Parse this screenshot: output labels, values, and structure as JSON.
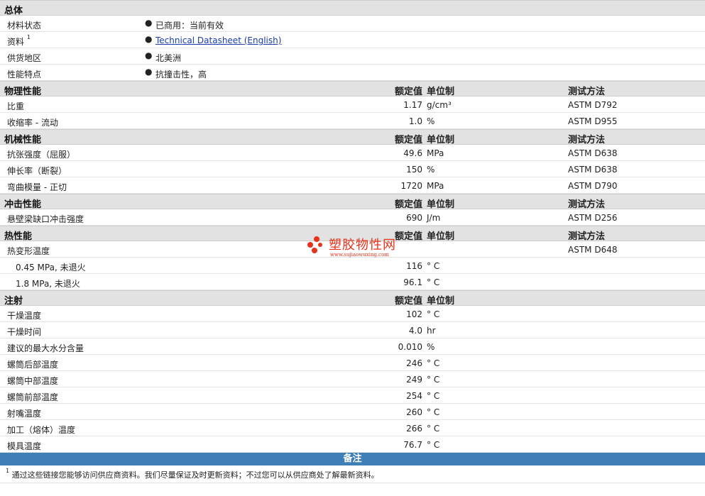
{
  "general": {
    "title": "总体",
    "rows": [
      {
        "label": "材料状态",
        "value": "已商用：当前有效"
      },
      {
        "label": "资料",
        "sup": "1",
        "value": "Technical Datasheet (English)",
        "link": true
      },
      {
        "label": "供货地区",
        "value": "北美洲"
      },
      {
        "label": "性能特点",
        "value": "抗撞击性，高"
      }
    ]
  },
  "cols": {
    "nominal": "额定值",
    "unit": "单位制",
    "method": "测试方法"
  },
  "sections": [
    {
      "title": "物理性能",
      "show_method": true,
      "rows": [
        {
          "label": "比重",
          "value": "1.17",
          "unit": "g/cm³",
          "method": "ASTM D792"
        },
        {
          "label": "收缩率 - 流动",
          "value": "1.0",
          "unit": "%",
          "method": "ASTM D955"
        }
      ]
    },
    {
      "title": "机械性能",
      "show_method": true,
      "rows": [
        {
          "label": "抗张强度（屈服）",
          "value": "49.6",
          "unit": "MPa",
          "method": "ASTM D638"
        },
        {
          "label": "伸长率（断裂）",
          "value": "150",
          "unit": "%",
          "method": "ASTM D638"
        },
        {
          "label": "弯曲模量 - 正切",
          "value": "1720",
          "unit": "MPa",
          "method": "ASTM D790"
        }
      ]
    },
    {
      "title": "冲击性能",
      "show_method": true,
      "rows": [
        {
          "label": "悬壁梁缺口冲击强度",
          "value": "690",
          "unit": "J/m",
          "method": "ASTM D256"
        }
      ]
    },
    {
      "title": "热性能",
      "show_method": true,
      "rows": [
        {
          "label": "热变形温度",
          "value": "",
          "unit": "",
          "method": "ASTM D648"
        },
        {
          "label": "0.45 MPa, 未退火",
          "value": "116",
          "unit": "° C",
          "method": "",
          "sub": true
        },
        {
          "label": "1.8 MPa, 未退火",
          "value": "96.1",
          "unit": "° C",
          "method": "",
          "sub": true
        }
      ]
    },
    {
      "title": "注射",
      "show_method": false,
      "rows": [
        {
          "label": "干燥温度",
          "value": "102",
          "unit": "° C",
          "method": ""
        },
        {
          "label": "干燥时间",
          "value": "4.0",
          "unit": "hr",
          "method": ""
        },
        {
          "label": "建议的最大水分含量",
          "value": "0.010",
          "unit": "%",
          "method": ""
        },
        {
          "label": "螺筒后部温度",
          "value": "246",
          "unit": "° C",
          "method": ""
        },
        {
          "label": "螺筒中部温度",
          "value": "249",
          "unit": "° C",
          "method": ""
        },
        {
          "label": "螺筒前部温度",
          "value": "254",
          "unit": "° C",
          "method": ""
        },
        {
          "label": "射嘴温度",
          "value": "260",
          "unit": "° C",
          "method": ""
        },
        {
          "label": "加工（熔体）温度",
          "value": "266",
          "unit": "° C",
          "method": ""
        },
        {
          "label": "模具温度",
          "value": "76.7",
          "unit": "° C",
          "method": ""
        }
      ]
    }
  ],
  "notes": {
    "title": "备注",
    "sup": "1",
    "text": "通过这些链接您能够访问供应商资料。我们尽量保证及时更新资料；不过您可以从供应商处了解最新资料。"
  },
  "watermark": {
    "name": "塑胶物性网",
    "url": "www.sujiaowuxing.com",
    "color": "#e8321a"
  }
}
